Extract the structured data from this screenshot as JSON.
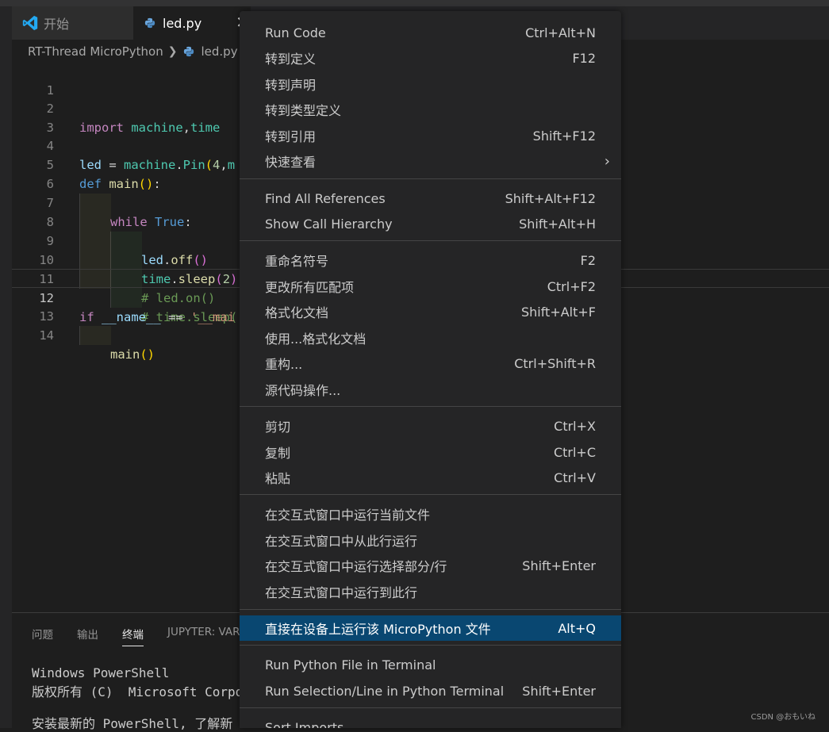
{
  "tabs": {
    "start": "开始",
    "file": "led.py",
    "close": "✕"
  },
  "breadcrumb": {
    "folder": "RT-Thread MicroPython",
    "file": "led.py"
  },
  "editor": {
    "line_numbers": [
      "1",
      "2",
      "3",
      "4",
      "5",
      "6",
      "7",
      "8",
      "9",
      "10",
      "11",
      "12",
      "13",
      "14"
    ],
    "active_line": "12",
    "code": {
      "l2": [
        "import",
        " ",
        "machine",
        ",",
        "time"
      ],
      "l4": [
        "led",
        " = ",
        "machine",
        ".",
        "Pin",
        "(",
        "4",
        ",",
        "m"
      ],
      "l5": [
        "def",
        " ",
        "main",
        "()",
        ":"
      ],
      "l6": [
        "while",
        " ",
        "True",
        ":"
      ],
      "l7": [
        "led",
        ".",
        "off",
        "()"
      ],
      "l8": [
        "time",
        ".",
        "sleep",
        "(",
        "2",
        ")"
      ],
      "l9": "# led.on()",
      "l10": "# time.sleep(",
      "l12": [
        "if",
        " ",
        "__name__",
        " == ",
        "'__mai"
      ],
      "l13": [
        "main",
        "()"
      ]
    }
  },
  "panel": {
    "tabs": [
      "问题",
      "输出",
      "终端",
      "JUPYTER: VARIA"
    ],
    "active_tab": "终端",
    "terminal_lines": [
      "Windows PowerShell",
      "版权所有 (C)  Microsoft Corpo",
      "安装最新的 PowerShell, 了解新"
    ]
  },
  "context_menu": {
    "groups": [
      [
        {
          "label": "Run Code",
          "key": "Ctrl+Alt+N"
        },
        {
          "label": "转到定义",
          "key": "F12"
        },
        {
          "label": "转到声明",
          "key": ""
        },
        {
          "label": "转到类型定义",
          "key": ""
        },
        {
          "label": "转到引用",
          "key": "Shift+F12"
        },
        {
          "label": "快速查看",
          "key": "",
          "submenu": "›"
        }
      ],
      [
        {
          "label": "Find All References",
          "key": "Shift+Alt+F12"
        },
        {
          "label": "Show Call Hierarchy",
          "key": "Shift+Alt+H"
        }
      ],
      [
        {
          "label": "重命名符号",
          "key": "F2"
        },
        {
          "label": "更改所有匹配项",
          "key": "Ctrl+F2"
        },
        {
          "label": "格式化文档",
          "key": "Shift+Alt+F"
        },
        {
          "label": "使用...格式化文档",
          "key": ""
        },
        {
          "label": "重构...",
          "key": "Ctrl+Shift+R"
        },
        {
          "label": "源代码操作...",
          "key": ""
        }
      ],
      [
        {
          "label": "剪切",
          "key": "Ctrl+X"
        },
        {
          "label": "复制",
          "key": "Ctrl+C"
        },
        {
          "label": "粘贴",
          "key": "Ctrl+V"
        }
      ],
      [
        {
          "label": "在交互式窗口中运行当前文件",
          "key": ""
        },
        {
          "label": "在交互式窗口中从此行运行",
          "key": ""
        },
        {
          "label": "在交互式窗口中运行选择部分/行",
          "key": "Shift+Enter"
        },
        {
          "label": "在交互式窗口中运行到此行",
          "key": ""
        }
      ],
      [
        {
          "label": "直接在设备上运行该 MicroPython 文件",
          "key": "Alt+Q",
          "selected": true
        }
      ],
      [
        {
          "label": "Run Python File in Terminal",
          "key": ""
        },
        {
          "label": "Run Selection/Line in Python Terminal",
          "key": "Shift+Enter"
        }
      ],
      [
        {
          "label": "Sort Imports",
          "key": ""
        }
      ]
    ]
  },
  "watermark": "CSDN @おもいね",
  "colors": {
    "menu_bg": "#252526",
    "menu_selected": "#094771",
    "editor_bg": "#1e1e1e",
    "vscode_blue": "#23a9f2"
  },
  "icons": {
    "app": "vscode-logo-icon",
    "python": "python-file-icon",
    "breadcrumb_sep": "chevron-right-icon",
    "submenu": "chevron-right-icon"
  }
}
